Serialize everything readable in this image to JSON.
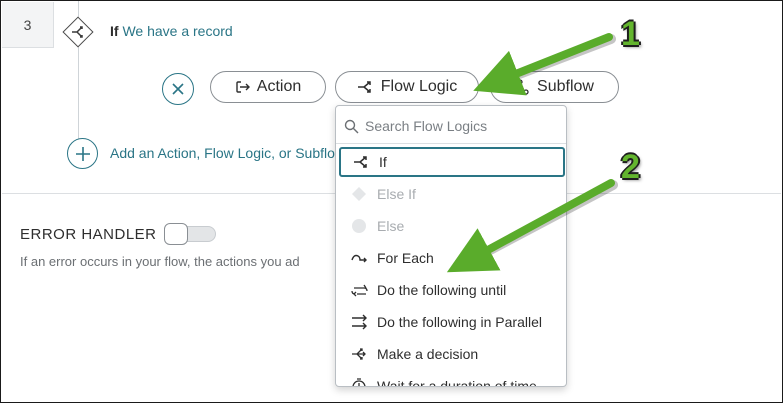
{
  "step": {
    "number": "3",
    "if_keyword": "If",
    "condition": "We have a record"
  },
  "action_bar": {
    "buttons": [
      {
        "label": "Action",
        "icon": "action-arrow-icon"
      },
      {
        "label": "Flow Logic",
        "icon": "flow-logic-icon"
      },
      {
        "label": "Subflow",
        "icon": "subflow-icon"
      }
    ]
  },
  "add_link": {
    "label": "Add an Action, Flow Logic, or Subflo"
  },
  "error_handler": {
    "title": "ERROR HANDLER",
    "enabled": false,
    "description": "If an error occurs in your flow, the actions you ad"
  },
  "flow_logic_menu": {
    "search_placeholder": "Search Flow Logics",
    "items": [
      {
        "label": "If",
        "icon": "if-branch-icon",
        "state": "selected"
      },
      {
        "label": "Else If",
        "icon": "else-if-diamond-icon",
        "state": "disabled"
      },
      {
        "label": "Else",
        "icon": "else-circle-icon",
        "state": "disabled"
      },
      {
        "label": "For Each",
        "icon": "for-each-icon",
        "state": "enabled"
      },
      {
        "label": "Do the following until",
        "icon": "loop-until-icon",
        "state": "enabled"
      },
      {
        "label": "Do the following in Parallel",
        "icon": "parallel-icon",
        "state": "enabled"
      },
      {
        "label": "Make a decision",
        "icon": "decision-icon",
        "state": "enabled"
      },
      {
        "label": "Wait for a duration of time",
        "icon": "wait-icon",
        "state": "enabled"
      }
    ]
  },
  "callouts": [
    "1",
    "2"
  ],
  "colors": {
    "accent": "#2a7586",
    "callout_arrow": "#5aac2b"
  }
}
